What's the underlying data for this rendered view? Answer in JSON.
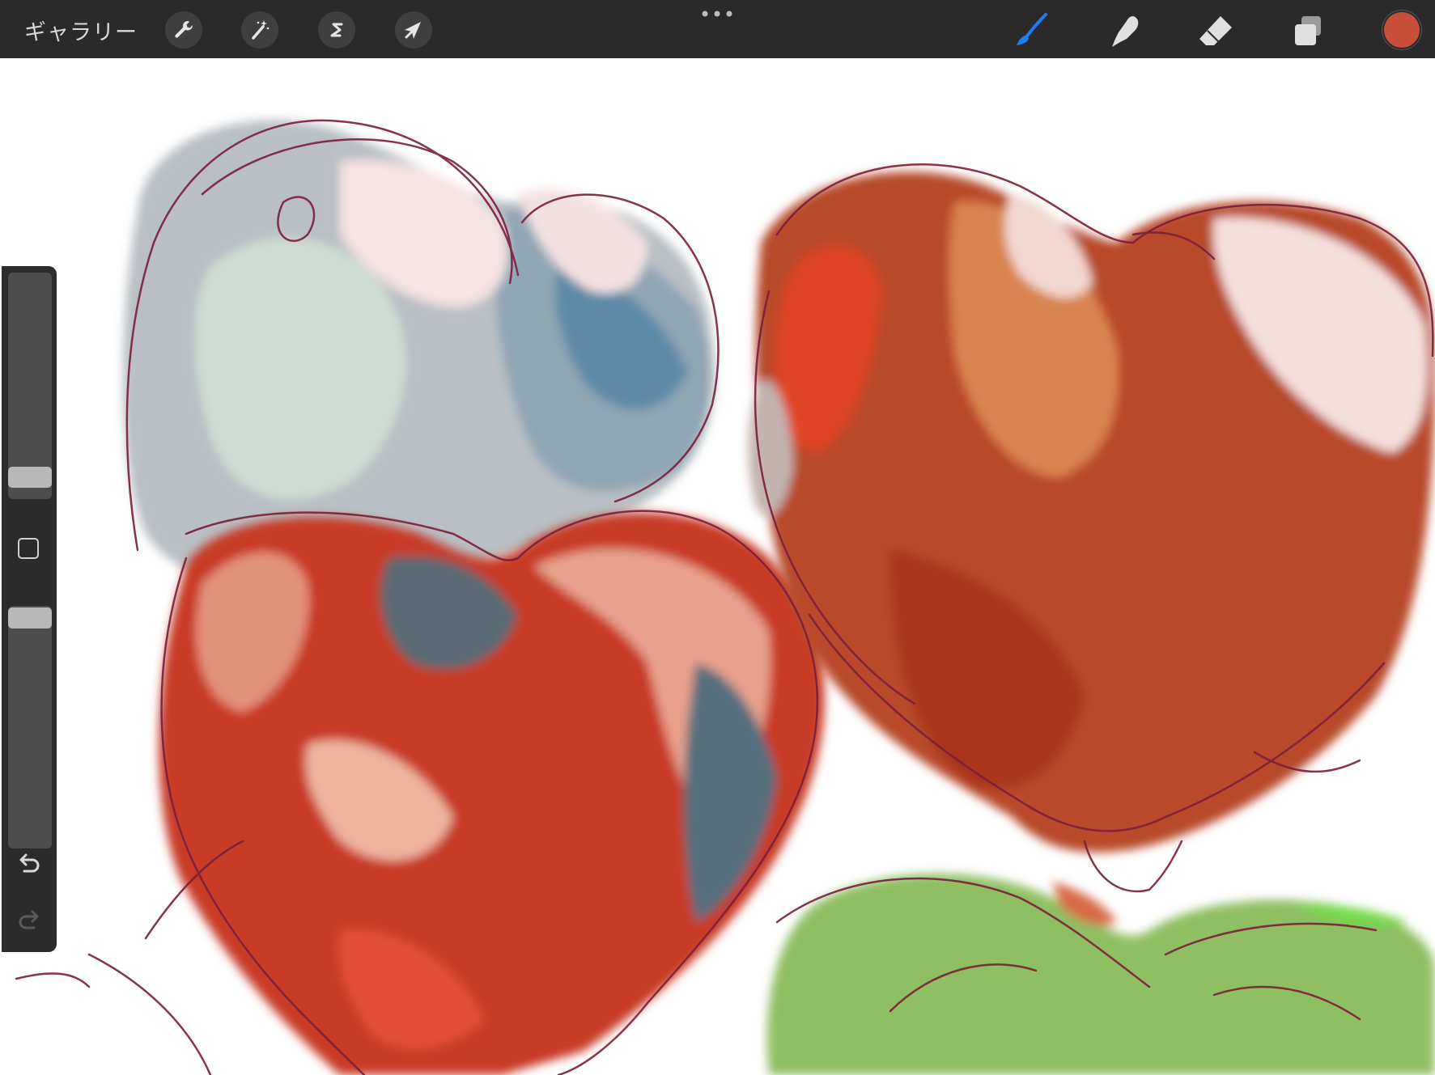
{
  "toolbar": {
    "gallery_label": "ギャラリー",
    "left_tools": [
      {
        "name": "actions",
        "icon": "wrench-icon"
      },
      {
        "name": "adjustments",
        "icon": "magic-wand-icon"
      },
      {
        "name": "selection",
        "icon": "selection-s-icon"
      },
      {
        "name": "transform",
        "icon": "arrow-cursor-icon"
      }
    ],
    "more_icon": "ellipsis-icon",
    "right_tools": [
      {
        "name": "brush",
        "icon": "brush-icon",
        "active": true
      },
      {
        "name": "smudge",
        "icon": "smudge-finger-icon"
      },
      {
        "name": "eraser",
        "icon": "eraser-icon"
      },
      {
        "name": "layers",
        "icon": "layers-icon"
      }
    ],
    "current_color": "#c8503a"
  },
  "sidebar": {
    "brush_size_level": 0.1,
    "opacity_level": 0.96,
    "modify_button_icon": "square-icon",
    "undo_icon": "undo-arrow-icon",
    "redo_icon": "redo-arrow-icon",
    "redo_enabled": false
  },
  "canvas": {
    "subject": "painted-hearts",
    "colors": {
      "pale_heart": "#b9c3c9",
      "red_heart": "#c83a28",
      "orange_heart": "#b84a2c",
      "green_shape": "#8fbf63",
      "sketch_line": "#7a1e3a",
      "accent_blue": "#5f8aa6"
    }
  }
}
